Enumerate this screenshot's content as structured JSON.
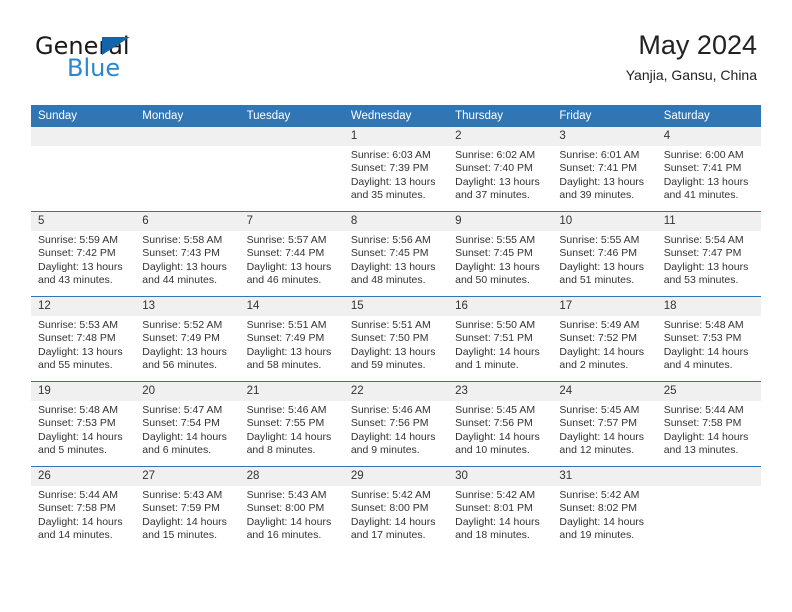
{
  "logo": {
    "word_one": "General",
    "word_two": "Blue",
    "triangle_color": "#1464aa",
    "blue_color": "#2b86d0"
  },
  "header": {
    "title": "May 2024",
    "subtitle": "Yanjia, Gansu, China"
  },
  "theme": {
    "header_blue": "#3076b5",
    "daynum_band": "#f0f0f0",
    "text": "#333333"
  },
  "weekday_headers": [
    "Sunday",
    "Monday",
    "Tuesday",
    "Wednesday",
    "Thursday",
    "Friday",
    "Saturday"
  ],
  "labels": {
    "sunrise": "Sunrise:",
    "sunset": "Sunset:",
    "daylight": "Daylight:"
  },
  "weeks": [
    [
      {
        "day": "",
        "sunrise": "",
        "sunset": "",
        "daylight": "",
        "empty": true
      },
      {
        "day": "",
        "sunrise": "",
        "sunset": "",
        "daylight": "",
        "empty": true
      },
      {
        "day": "",
        "sunrise": "",
        "sunset": "",
        "daylight": "",
        "empty": true
      },
      {
        "day": "1",
        "sunrise": "Sunrise: 6:03 AM",
        "sunset": "Sunset: 7:39 PM",
        "daylight": "Daylight: 13 hours and 35 minutes.",
        "empty": false
      },
      {
        "day": "2",
        "sunrise": "Sunrise: 6:02 AM",
        "sunset": "Sunset: 7:40 PM",
        "daylight": "Daylight: 13 hours and 37 minutes.",
        "empty": false
      },
      {
        "day": "3",
        "sunrise": "Sunrise: 6:01 AM",
        "sunset": "Sunset: 7:41 PM",
        "daylight": "Daylight: 13 hours and 39 minutes.",
        "empty": false
      },
      {
        "day": "4",
        "sunrise": "Sunrise: 6:00 AM",
        "sunset": "Sunset: 7:41 PM",
        "daylight": "Daylight: 13 hours and 41 minutes.",
        "empty": false
      }
    ],
    [
      {
        "day": "5",
        "sunrise": "Sunrise: 5:59 AM",
        "sunset": "Sunset: 7:42 PM",
        "daylight": "Daylight: 13 hours and 43 minutes.",
        "empty": false
      },
      {
        "day": "6",
        "sunrise": "Sunrise: 5:58 AM",
        "sunset": "Sunset: 7:43 PM",
        "daylight": "Daylight: 13 hours and 44 minutes.",
        "empty": false
      },
      {
        "day": "7",
        "sunrise": "Sunrise: 5:57 AM",
        "sunset": "Sunset: 7:44 PM",
        "daylight": "Daylight: 13 hours and 46 minutes.",
        "empty": false
      },
      {
        "day": "8",
        "sunrise": "Sunrise: 5:56 AM",
        "sunset": "Sunset: 7:45 PM",
        "daylight": "Daylight: 13 hours and 48 minutes.",
        "empty": false
      },
      {
        "day": "9",
        "sunrise": "Sunrise: 5:55 AM",
        "sunset": "Sunset: 7:45 PM",
        "daylight": "Daylight: 13 hours and 50 minutes.",
        "empty": false
      },
      {
        "day": "10",
        "sunrise": "Sunrise: 5:55 AM",
        "sunset": "Sunset: 7:46 PM",
        "daylight": "Daylight: 13 hours and 51 minutes.",
        "empty": false
      },
      {
        "day": "11",
        "sunrise": "Sunrise: 5:54 AM",
        "sunset": "Sunset: 7:47 PM",
        "daylight": "Daylight: 13 hours and 53 minutes.",
        "empty": false
      }
    ],
    [
      {
        "day": "12",
        "sunrise": "Sunrise: 5:53 AM",
        "sunset": "Sunset: 7:48 PM",
        "daylight": "Daylight: 13 hours and 55 minutes.",
        "empty": false
      },
      {
        "day": "13",
        "sunrise": "Sunrise: 5:52 AM",
        "sunset": "Sunset: 7:49 PM",
        "daylight": "Daylight: 13 hours and 56 minutes.",
        "empty": false
      },
      {
        "day": "14",
        "sunrise": "Sunrise: 5:51 AM",
        "sunset": "Sunset: 7:49 PM",
        "daylight": "Daylight: 13 hours and 58 minutes.",
        "empty": false
      },
      {
        "day": "15",
        "sunrise": "Sunrise: 5:51 AM",
        "sunset": "Sunset: 7:50 PM",
        "daylight": "Daylight: 13 hours and 59 minutes.",
        "empty": false
      },
      {
        "day": "16",
        "sunrise": "Sunrise: 5:50 AM",
        "sunset": "Sunset: 7:51 PM",
        "daylight": "Daylight: 14 hours and 1 minute.",
        "empty": false
      },
      {
        "day": "17",
        "sunrise": "Sunrise: 5:49 AM",
        "sunset": "Sunset: 7:52 PM",
        "daylight": "Daylight: 14 hours and 2 minutes.",
        "empty": false
      },
      {
        "day": "18",
        "sunrise": "Sunrise: 5:48 AM",
        "sunset": "Sunset: 7:53 PM",
        "daylight": "Daylight: 14 hours and 4 minutes.",
        "empty": false
      }
    ],
    [
      {
        "day": "19",
        "sunrise": "Sunrise: 5:48 AM",
        "sunset": "Sunset: 7:53 PM",
        "daylight": "Daylight: 14 hours and 5 minutes.",
        "empty": false
      },
      {
        "day": "20",
        "sunrise": "Sunrise: 5:47 AM",
        "sunset": "Sunset: 7:54 PM",
        "daylight": "Daylight: 14 hours and 6 minutes.",
        "empty": false
      },
      {
        "day": "21",
        "sunrise": "Sunrise: 5:46 AM",
        "sunset": "Sunset: 7:55 PM",
        "daylight": "Daylight: 14 hours and 8 minutes.",
        "empty": false
      },
      {
        "day": "22",
        "sunrise": "Sunrise: 5:46 AM",
        "sunset": "Sunset: 7:56 PM",
        "daylight": "Daylight: 14 hours and 9 minutes.",
        "empty": false
      },
      {
        "day": "23",
        "sunrise": "Sunrise: 5:45 AM",
        "sunset": "Sunset: 7:56 PM",
        "daylight": "Daylight: 14 hours and 10 minutes.",
        "empty": false
      },
      {
        "day": "24",
        "sunrise": "Sunrise: 5:45 AM",
        "sunset": "Sunset: 7:57 PM",
        "daylight": "Daylight: 14 hours and 12 minutes.",
        "empty": false
      },
      {
        "day": "25",
        "sunrise": "Sunrise: 5:44 AM",
        "sunset": "Sunset: 7:58 PM",
        "daylight": "Daylight: 14 hours and 13 minutes.",
        "empty": false
      }
    ],
    [
      {
        "day": "26",
        "sunrise": "Sunrise: 5:44 AM",
        "sunset": "Sunset: 7:58 PM",
        "daylight": "Daylight: 14 hours and 14 minutes.",
        "empty": false
      },
      {
        "day": "27",
        "sunrise": "Sunrise: 5:43 AM",
        "sunset": "Sunset: 7:59 PM",
        "daylight": "Daylight: 14 hours and 15 minutes.",
        "empty": false
      },
      {
        "day": "28",
        "sunrise": "Sunrise: 5:43 AM",
        "sunset": "Sunset: 8:00 PM",
        "daylight": "Daylight: 14 hours and 16 minutes.",
        "empty": false
      },
      {
        "day": "29",
        "sunrise": "Sunrise: 5:42 AM",
        "sunset": "Sunset: 8:00 PM",
        "daylight": "Daylight: 14 hours and 17 minutes.",
        "empty": false
      },
      {
        "day": "30",
        "sunrise": "Sunrise: 5:42 AM",
        "sunset": "Sunset: 8:01 PM",
        "daylight": "Daylight: 14 hours and 18 minutes.",
        "empty": false
      },
      {
        "day": "31",
        "sunrise": "Sunrise: 5:42 AM",
        "sunset": "Sunset: 8:02 PM",
        "daylight": "Daylight: 14 hours and 19 minutes.",
        "empty": false
      },
      {
        "day": "",
        "sunrise": "",
        "sunset": "",
        "daylight": "",
        "empty": true
      }
    ]
  ]
}
